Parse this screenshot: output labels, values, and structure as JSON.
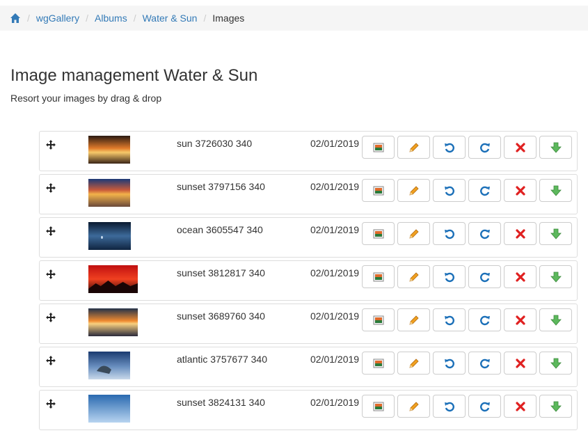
{
  "breadcrumb": {
    "home_icon": "home-icon",
    "items": [
      "wgGallery",
      "Albums",
      "Water & Sun"
    ],
    "active": "Images"
  },
  "page": {
    "title": "Image management Water & Sun",
    "subtitle": "Resort your images by drag & drop"
  },
  "colors": {
    "link": "#337ab7",
    "rotate": "#1a6fb8",
    "pencil": "#f0a020",
    "delete": "#e02020",
    "download": "#5cb85c"
  },
  "images": [
    {
      "name": "sun 3726030 340",
      "date": "02/01/2019",
      "thumb_width": 60
    },
    {
      "name": "sunset 3797156 340",
      "date": "02/01/2019",
      "thumb_width": 60
    },
    {
      "name": "ocean 3605547 340",
      "date": "02/01/2019",
      "thumb_width": 61
    },
    {
      "name": "sunset 3812817 340",
      "date": "02/01/2019",
      "thumb_width": 71
    },
    {
      "name": "sunset 3689760 340",
      "date": "02/01/2019",
      "thumb_width": 71
    },
    {
      "name": "atlantic 3757677 340",
      "date": "02/01/2019",
      "thumb_width": 60
    },
    {
      "name": "sunset 3824131 340",
      "date": "02/01/2019",
      "thumb_width": 60
    }
  ],
  "row_actions": [
    "image-preview-icon",
    "pencil-icon",
    "rotate-left-icon",
    "rotate-right-icon",
    "delete-icon",
    "download-icon"
  ]
}
